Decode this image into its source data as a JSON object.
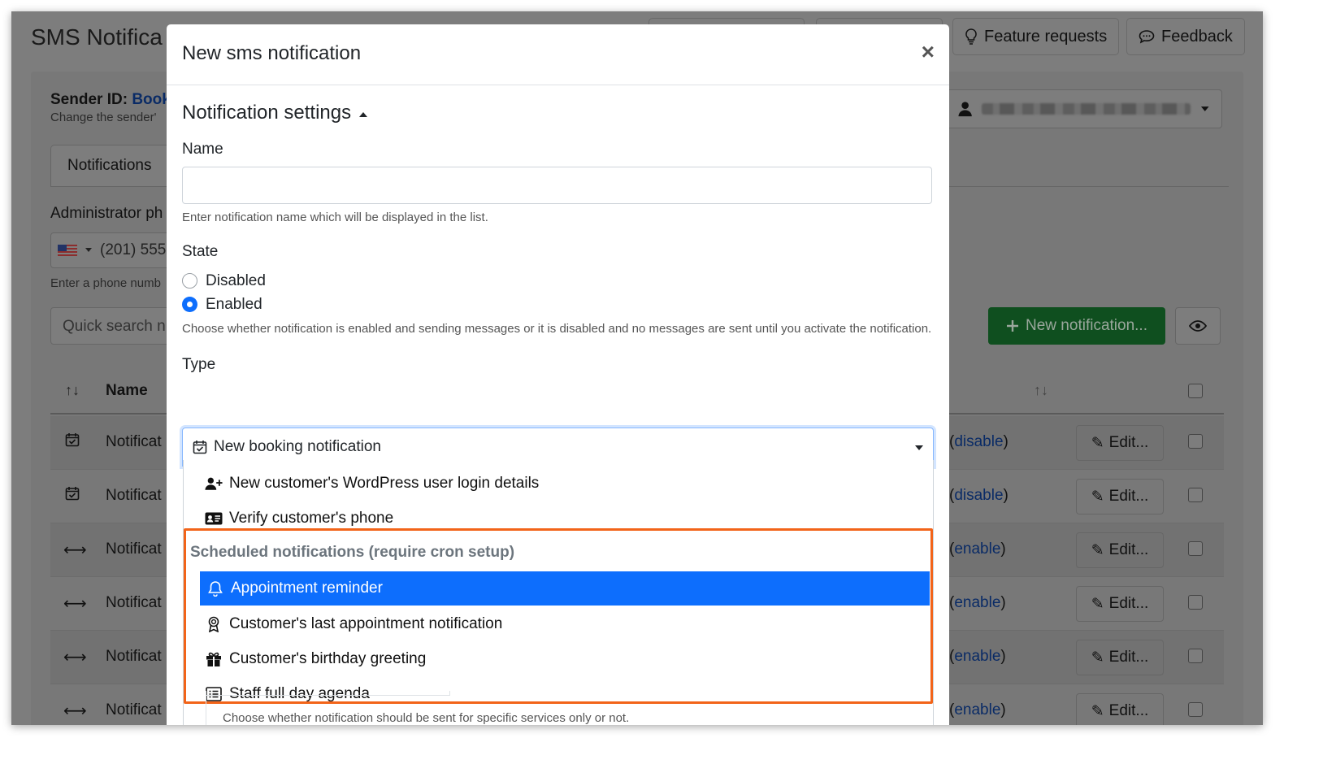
{
  "background": {
    "app_title": "SMS Notifica",
    "top_buttons": [
      {
        "label": "Feature requests",
        "icon": "lightbulb-icon"
      },
      {
        "label": "Feedback",
        "icon": "chat-icon"
      }
    ],
    "sender_label": "Sender ID:",
    "sender_link": "Book",
    "sender_help": "Change the sender'",
    "tab_notifications": "Notifications",
    "admin_phone_label": "Administrator ph",
    "phone_value": "(201) 555",
    "phone_help": "Enter a phone numb",
    "quick_search_placeholder": "Quick search n",
    "new_notification_button": "New notification...",
    "table_header_name": "Name",
    "rows": [
      {
        "icon": "calendar-check-icon",
        "name": "Notificat",
        "toggle": "disable",
        "edit": "Edit..."
      },
      {
        "icon": "calendar-check-icon",
        "name": "Notificat",
        "toggle": "disable",
        "edit": "Edit..."
      },
      {
        "icon": "arrows-horizontal-icon",
        "name": "Notificat",
        "toggle": "enable",
        "edit": "Edit..."
      },
      {
        "icon": "arrows-horizontal-icon",
        "name": "Notificat",
        "toggle": "enable",
        "edit": "Edit..."
      },
      {
        "icon": "arrows-horizontal-icon",
        "name": "Notificat",
        "toggle": "enable",
        "edit": "Edit..."
      },
      {
        "icon": "arrows-horizontal-icon",
        "name": "Notificat",
        "toggle": "enable",
        "edit": "Edit..."
      }
    ]
  },
  "modal": {
    "title": "New sms notification",
    "close_symbol": "×",
    "section_title": "Notification settings",
    "name_label": "Name",
    "name_value": "",
    "name_help": "Enter notification name which will be displayed in the list.",
    "state_label": "State",
    "state_options": [
      "Disabled",
      "Enabled"
    ],
    "state_selected": "Enabled",
    "state_help": "Choose whether notification is enabled and sending messages or it is disabled and no messages are sent until you activate the notification.",
    "type_label": "Type",
    "type_selected": "New booking notification",
    "type_selected_icon": "calendar-check-icon",
    "dropdown": {
      "options_top": [
        {
          "label": "New customer's WordPress user login details",
          "icon": "user-plus-icon"
        },
        {
          "label": "Verify customer's phone",
          "icon": "id-card-icon"
        }
      ],
      "group_label": "Scheduled notifications (require cron setup)",
      "group_options": [
        {
          "label": "Appointment reminder",
          "icon": "bell-icon",
          "selected": true
        },
        {
          "label": "Customer's last appointment notification",
          "icon": "award-icon",
          "selected": false
        },
        {
          "label": "Customer's birthday greeting",
          "icon": "gift-icon",
          "selected": false
        },
        {
          "label": "Staff full day agenda",
          "icon": "list-alt-icon",
          "selected": false
        }
      ]
    },
    "services_help": "Choose whether notification should be sent for specific services only or not."
  },
  "colors": {
    "accent": "#0d6efd",
    "highlight_border": "#f26419",
    "success_button": "#198754"
  }
}
